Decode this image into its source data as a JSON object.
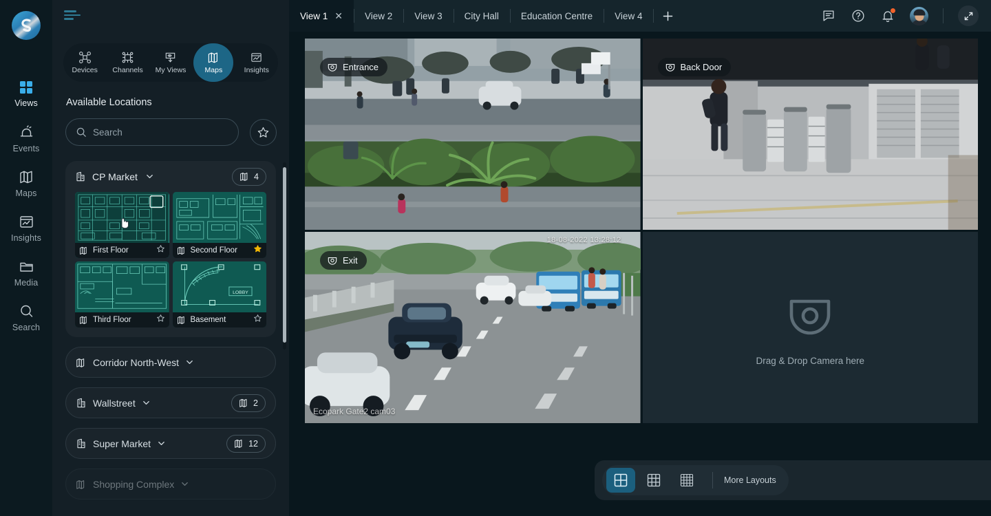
{
  "app": {
    "logo_icon": "shield-logo-icon",
    "menu_icon": "hamburger-menu-icon"
  },
  "rail": {
    "items": [
      {
        "label": "Views",
        "icon": "grid-squares-icon",
        "active": true
      },
      {
        "label": "Events",
        "icon": "alarm-bell-icon",
        "active": false
      },
      {
        "label": "Maps",
        "icon": "map-fold-icon",
        "active": false
      },
      {
        "label": "Insights",
        "icon": "chart-window-icon",
        "active": false
      },
      {
        "label": "Media",
        "icon": "folder-icon",
        "active": false
      },
      {
        "label": "Search",
        "icon": "magnifier-icon",
        "active": false
      }
    ]
  },
  "panel": {
    "segments": [
      {
        "label": "Devices",
        "icon": "drone-icon",
        "active": false
      },
      {
        "label": "Channels",
        "icon": "channels-icon",
        "active": false
      },
      {
        "label": "My Views",
        "icon": "eye-views-icon",
        "active": false
      },
      {
        "label": "Maps",
        "icon": "map-fold-icon",
        "active": true
      },
      {
        "label": "Insights",
        "icon": "chart-window-icon",
        "active": false
      }
    ],
    "title": "Available Locations",
    "search": {
      "placeholder": "Search",
      "value": "",
      "icon": "search-icon"
    },
    "favorites_button_icon": "star-outline-icon",
    "locations": [
      {
        "name": "CP Market",
        "icon": "building-icon",
        "expanded": true,
        "count": "4",
        "count_icon": "map-fold-icon",
        "floors": [
          {
            "name": "First Floor",
            "icon": "map-fold-icon",
            "favorite": false,
            "selected": true,
            "plan": "first"
          },
          {
            "name": "Second Floor",
            "icon": "map-fold-icon",
            "favorite": true,
            "selected": false,
            "plan": "second"
          },
          {
            "name": "Third Floor",
            "icon": "map-fold-icon",
            "favorite": false,
            "selected": false,
            "plan": "third"
          },
          {
            "name": "Basement",
            "icon": "map-fold-icon",
            "favorite": false,
            "selected": false,
            "plan": "basement"
          }
        ]
      },
      {
        "name": "Corridor North-West",
        "icon": "map-fold-icon",
        "expanded": false,
        "count": "",
        "dim": false
      },
      {
        "name": "Wallstreet",
        "icon": "building-icon",
        "expanded": false,
        "count": "2",
        "dim": false
      },
      {
        "name": "Super Market",
        "icon": "building-icon",
        "expanded": false,
        "count": "12",
        "dim": false
      },
      {
        "name": "Shopping Complex",
        "icon": "map-fold-icon",
        "expanded": false,
        "count": "",
        "dim": true
      }
    ],
    "basement_plan_label": "LOBBY"
  },
  "tabs": {
    "items": [
      {
        "label": "View 1",
        "active": true,
        "closable": true
      },
      {
        "label": "View 2",
        "active": false,
        "closable": false
      },
      {
        "label": "View 3",
        "active": false,
        "closable": false
      },
      {
        "label": "City Hall",
        "active": false,
        "closable": false
      },
      {
        "label": "Education Centre",
        "active": false,
        "closable": false
      },
      {
        "label": "View 4",
        "active": false,
        "closable": false
      }
    ],
    "add_icon": "plus-icon",
    "close_glyph": "✕",
    "right_icons": [
      {
        "name": "chat-message-icon"
      },
      {
        "name": "help-circle-icon"
      },
      {
        "name": "notification-bell-icon"
      }
    ],
    "expand_icon": "expand-fullscreen-icon"
  },
  "grid": {
    "cells": [
      {
        "camera": "Entrance",
        "icon": "cctv-dome-icon",
        "empty": false,
        "timestamp": "",
        "watermark": ""
      },
      {
        "camera": "Back Door",
        "icon": "cctv-dome-icon",
        "empty": false,
        "timestamp": "",
        "watermark": ""
      },
      {
        "camera": "Exit",
        "icon": "cctv-dome-icon",
        "empty": false,
        "timestamp": "18-08-2022 13:28:12",
        "watermark": "Ecopark Gate2 cam03"
      },
      {
        "camera": "",
        "icon": "cctv-dome-icon",
        "empty": true,
        "empty_text": "Drag & Drop Camera here",
        "timestamp": "",
        "watermark": ""
      }
    ]
  },
  "bottom": {
    "layouts": [
      {
        "name": "layout-2x2",
        "cells": 2,
        "active": true
      },
      {
        "name": "layout-3x3",
        "cells": 3,
        "active": false
      },
      {
        "name": "layout-4x4",
        "cells": 4,
        "active": false
      }
    ],
    "more_label": "More Layouts",
    "save_icon": "save-disk-icon"
  },
  "colors": {
    "accent": "#1d6686",
    "rail_bg": "#0c1a20",
    "panel_bg": "#141f26",
    "main_bg": "#09171d",
    "tabbar_bg": "#15252c",
    "plan_teal": "#0e4b45",
    "favorite_star": "#f2b705",
    "notification_dot": "#f2622a"
  }
}
